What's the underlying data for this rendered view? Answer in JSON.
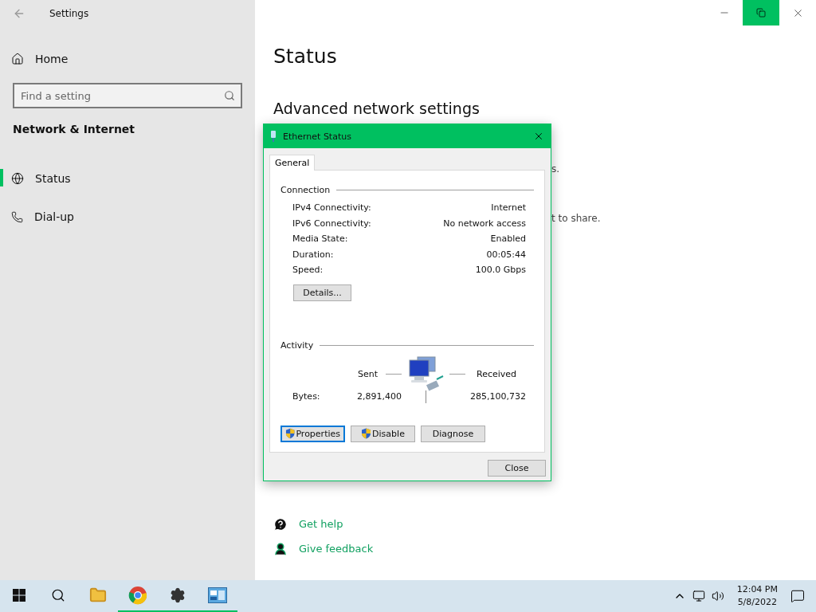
{
  "settings": {
    "title": "Settings",
    "home": "Home",
    "search": {
      "placeholder": "Find a setting"
    },
    "section": "Network & Internet",
    "items": [
      {
        "label": "Status",
        "kind": "globe",
        "selected": true
      },
      {
        "label": "Dial-up",
        "kind": "phone",
        "selected": false
      }
    ]
  },
  "main": {
    "heading": "Status",
    "subheading": "Advanced network settings",
    "fragments": [
      "s.",
      "t to share."
    ],
    "links": [
      {
        "label": "Get help",
        "kind": "help"
      },
      {
        "label": "Give feedback",
        "kind": "feedback"
      }
    ]
  },
  "dialog": {
    "title": "Ethernet Status",
    "tabs": [
      {
        "label": "General",
        "selected": true
      }
    ],
    "connection": {
      "title": "Connection",
      "rows": [
        {
          "label": "IPv4 Connectivity:",
          "value": "Internet"
        },
        {
          "label": "IPv6 Connectivity:",
          "value": "No network access"
        },
        {
          "label": "Media State:",
          "value": "Enabled"
        },
        {
          "label": "Duration:",
          "value": "00:05:44"
        },
        {
          "label": "Speed:",
          "value": "100.0 Gbps"
        }
      ],
      "button": "Details..."
    },
    "activity": {
      "title": "Activity",
      "sent_label": "Sent",
      "received_label": "Received",
      "bytes_label": "Bytes:",
      "sent": "2,891,400",
      "received": "285,100,732"
    },
    "buttons": [
      {
        "label": "Properties",
        "shield": true,
        "focused": true
      },
      {
        "label": "Disable",
        "shield": true,
        "focused": false
      },
      {
        "label": "Diagnose",
        "shield": false,
        "focused": false
      }
    ],
    "close": "Close"
  },
  "taskbar": {
    "apps": [
      {
        "kind": "start",
        "running": false
      },
      {
        "kind": "search",
        "running": false
      },
      {
        "kind": "folder",
        "running": false
      },
      {
        "kind": "browser",
        "running": true
      },
      {
        "kind": "gear",
        "running": true
      },
      {
        "kind": "panel",
        "running": true
      }
    ],
    "time": "12:04 PM",
    "date": "5/8/2022"
  }
}
